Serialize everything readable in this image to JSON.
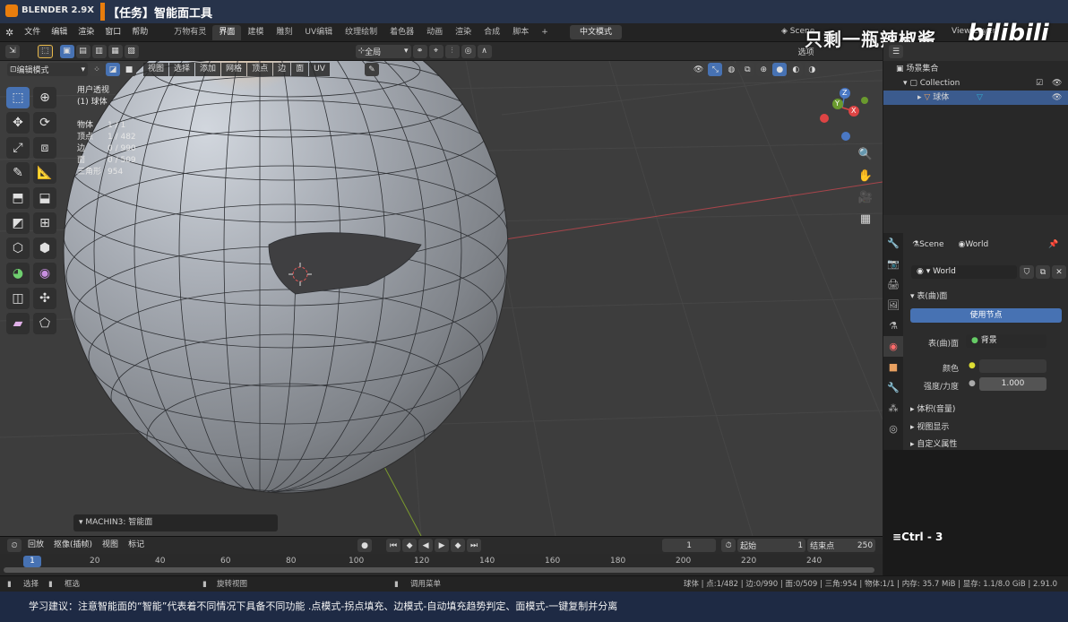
{
  "titlebar": {
    "app_name": "BLENDER 2.9X",
    "task": "【任务】智能面工具"
  },
  "menubar": {
    "items": [
      "文件",
      "编辑",
      "渲染",
      "窗口",
      "帮助"
    ],
    "workspaces": [
      "万物有灵",
      "界面",
      "建模",
      "雕刻",
      "UV编辑",
      "纹理绘制",
      "着色器",
      "动画",
      "渲染",
      "合成",
      "脚本"
    ],
    "active_workspace": "界面",
    "add_tab": "+",
    "language_mode": "中文模式",
    "scene": "Scene",
    "view_layer": "View Layer"
  },
  "watermark": {
    "text": "只剩一瓶辣椒酱",
    "brand": "bilibili"
  },
  "tool_header": {
    "transform_orientation": "全局",
    "options_label": "选项"
  },
  "viewport_header": {
    "mode": "编辑模式",
    "menus": [
      "视图",
      "选择",
      "添加",
      "网格",
      "顶点",
      "边",
      "面",
      "UV"
    ]
  },
  "viewport": {
    "view_name": "用户透视",
    "object_name": "(1) 球体",
    "stats": [
      {
        "label": "物体",
        "value": "1 / 1"
      },
      {
        "label": "顶点",
        "value": "1 / 482"
      },
      {
        "label": "边",
        "value": "0 / 990"
      },
      {
        "label": "面",
        "value": "0 / 509"
      },
      {
        "label": "三角形",
        "value": "954"
      }
    ],
    "gizmo": {
      "x": "X",
      "y": "Y",
      "z": "Z"
    },
    "last_operator": "MACHIN3: 智能面"
  },
  "outliner": {
    "scene_collection": "场景集合",
    "collection": "Collection",
    "object": "球体"
  },
  "properties": {
    "breadcrumb_scene": "Scene",
    "breadcrumb_world": "World",
    "world_name": "World",
    "surface_section": "表(曲)面",
    "use_nodes_button": "使用节点",
    "surface_label": "表(曲)面",
    "surface_value": "背景",
    "color_label": "颜色",
    "strength_label": "强度/力度",
    "strength_value": "1.000",
    "volume_section": "体积(音量)",
    "viewport_display_section": "视图显示",
    "custom_props_section": "自定义属性"
  },
  "keycast": {
    "text": "Ctrl - 3"
  },
  "timeline": {
    "menus": [
      "回放",
      "抠像(插帧)",
      "视图",
      "标记"
    ],
    "current_frame": "1",
    "start_label": "起始",
    "start_value": "1",
    "end_label": "结束点",
    "end_value": "250",
    "ticks": [
      "1",
      "20",
      "40",
      "60",
      "80",
      "100",
      "120",
      "140",
      "160",
      "180",
      "200",
      "220",
      "240"
    ]
  },
  "statusbar": {
    "left": [
      {
        "label": "选择"
      },
      {
        "label": "框选"
      },
      {
        "label": "旋转视图"
      },
      {
        "label": "调用菜单"
      }
    ],
    "right": "球体 | 点:1/482 | 边:0/990 | 面:0/509 | 三角:954 | 物体:1/1 | 内存: 35.7 MiB | 显存: 1.1/8.0 GiB | 2.91.0"
  },
  "subtitle": "学习建议：注意智能面的“智能”代表着不同情况下具备不同功能 .点模式-拐点填充、边模式-自动填充趋势判定、面模式-一键复制并分离",
  "colors": {
    "accent": "#4772b3",
    "orange": "#e87d0d",
    "subtitle_bg": "#1e2a44"
  }
}
